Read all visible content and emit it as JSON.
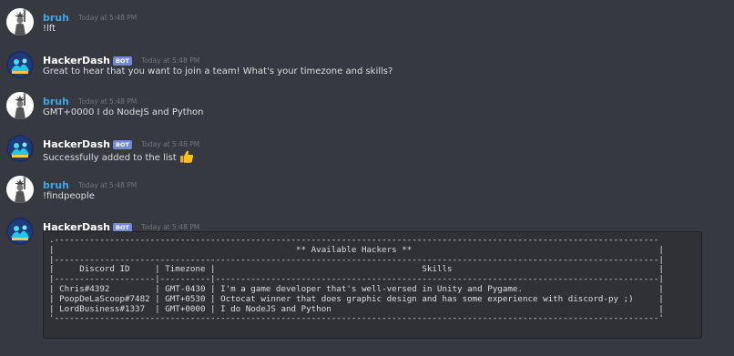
{
  "messages": [
    {
      "author": "bruh",
      "timestamp": "Today at 5:48 PM",
      "content": "!lft"
    },
    {
      "author": "HackerDash",
      "bot_tag": "BOT",
      "timestamp": "Today at 5:48 PM",
      "content": "Great to hear that you want to join a team! What's your timezone and skills?"
    },
    {
      "author": "bruh",
      "timestamp": "Today at 5:48 PM",
      "content": "GMT+0000 I do NodeJS and Python"
    },
    {
      "author": "HackerDash",
      "bot_tag": "BOT",
      "timestamp": "Today at 5:48 PM",
      "content": "Successfully added to the list",
      "emoji": "thumbs-up-emoji"
    },
    {
      "author": "bruh",
      "timestamp": "Today at 5:48 PM",
      "content": "!findpeople"
    },
    {
      "author": "HackerDash",
      "bot_tag": "BOT",
      "timestamp": "Today at 5:48 PM"
    }
  ],
  "table": {
    "title": "** Available Hackers **",
    "columns": [
      "Discord ID",
      "Timezone",
      "Skills"
    ],
    "rows": [
      [
        "Chris#4392",
        "GMT-0430",
        "I'm a game developer that's well-versed in Unity and Pygame."
      ],
      [
        "PoopDeLaScoop#7482",
        "GMT+0530",
        "Octocat winner that does graphic design and has some experience with discord-py ;)"
      ],
      [
        "LordBusiness#1337",
        "GMT+0000",
        "I do NodeJS and Python"
      ]
    ]
  },
  "colors": {
    "background": "#36393f",
    "user_name": "#3fa6e4",
    "bot_tag": "#7289da",
    "timestamp": "#72767d",
    "codeblock_bg": "#2f3136"
  }
}
